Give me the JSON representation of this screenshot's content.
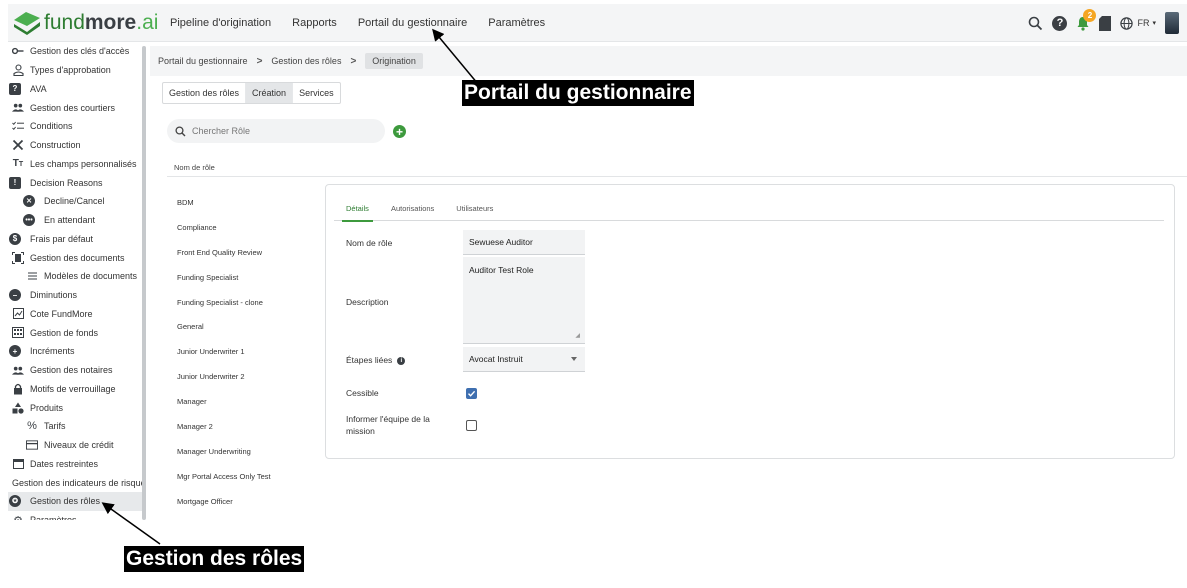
{
  "brand": {
    "logo_main": "fund",
    "logo_bold": "more",
    "logo_suffix": ".ai"
  },
  "nav": {
    "items": [
      "Pipeline d'origination",
      "Rapports",
      "Portail du gestionnaire",
      "Paramètres"
    ]
  },
  "header": {
    "notification_count": "2",
    "language": "FR"
  },
  "sidebar": {
    "items": [
      {
        "label": "Gestion des clés d'accès",
        "icon": "key-icon"
      },
      {
        "label": "Types d'approbation",
        "icon": "person-outline-icon"
      },
      {
        "label": "AVA",
        "icon": "question-square-icon"
      },
      {
        "label": "Gestion des courtiers",
        "icon": "people-icon"
      },
      {
        "label": "Conditions",
        "icon": "checklist-icon"
      },
      {
        "label": "Construction",
        "icon": "tools-icon"
      },
      {
        "label": "Les champs personnalisés",
        "icon": "text-size-icon"
      },
      {
        "label": "Decision Reasons",
        "icon": "alert-square-icon"
      },
      {
        "label": "Decline/Cancel",
        "icon": "cancel-circle-icon"
      },
      {
        "label": "En attendant",
        "icon": "pending-circle-icon"
      },
      {
        "label": "Frais par défaut",
        "icon": "dollar-circle-icon"
      },
      {
        "label": "Gestion des documents",
        "icon": "document-scan-icon"
      },
      {
        "label": "Modèles de documents",
        "icon": "document-lines-icon"
      },
      {
        "label": "Diminutions",
        "icon": "minus-circle-icon"
      },
      {
        "label": "Cote FundMore",
        "icon": "chart-box-icon"
      },
      {
        "label": "Gestion de fonds",
        "icon": "building-icon"
      },
      {
        "label": "Incréments",
        "icon": "plus-circle-icon"
      },
      {
        "label": "Gestion des notaires",
        "icon": "people-icon"
      },
      {
        "label": "Motifs de verrouillage",
        "icon": "lock-icon"
      },
      {
        "label": "Produits",
        "icon": "shapes-icon"
      },
      {
        "label": "Tarifs",
        "icon": "percent-icon"
      },
      {
        "label": "Niveaux de crédit",
        "icon": "credit-card-icon"
      },
      {
        "label": "Dates restreintes",
        "icon": "calendar-icon"
      },
      {
        "label": "Gestion des indicateurs de risque",
        "icon": ""
      },
      {
        "label": "Gestion des rôles",
        "icon": "roles-circle-icon"
      },
      {
        "label": "Paramètres",
        "icon": "gear-icon"
      }
    ]
  },
  "breadcrumb": {
    "items": [
      "Portail du gestionnaire",
      "Gestion des rôles",
      "Origination"
    ]
  },
  "tabs": [
    "Gestion des rôles",
    "Création",
    "Services"
  ],
  "search": {
    "placeholder": "Chercher Rôle"
  },
  "table": {
    "column_header": "Nom de rôle"
  },
  "roles": [
    "BDM",
    "Compliance",
    "Front End Quality Review",
    "Funding Specialist",
    "Funding Specialist - clone",
    "General",
    "Junior Underwriter 1",
    "Junior Underwriter 2",
    "Manager",
    "Manager 2",
    "Manager Underwriting",
    "Mgr Portal Access Only Test",
    "Mortgage Officer"
  ],
  "detail": {
    "tabs": [
      "Détails",
      "Autorisations",
      "Utilisateurs"
    ],
    "fields": {
      "role_name_label": "Nom de rôle",
      "role_name_value": "Sewuese Auditor",
      "description_label": "Description",
      "description_value": "Auditor Test Role",
      "stages_label": "Étapes liées",
      "stages_value": "Avocat Instruit",
      "transferable_label": "Cessible",
      "transferable_checked": true,
      "inform_label_line1": "Informer l'équipe de la",
      "inform_label_line2": "mission",
      "inform_checked": false
    }
  },
  "annotations": {
    "top_callout": "Portail du gestionnaire",
    "bottom_callout": "Gestion des rôles"
  }
}
